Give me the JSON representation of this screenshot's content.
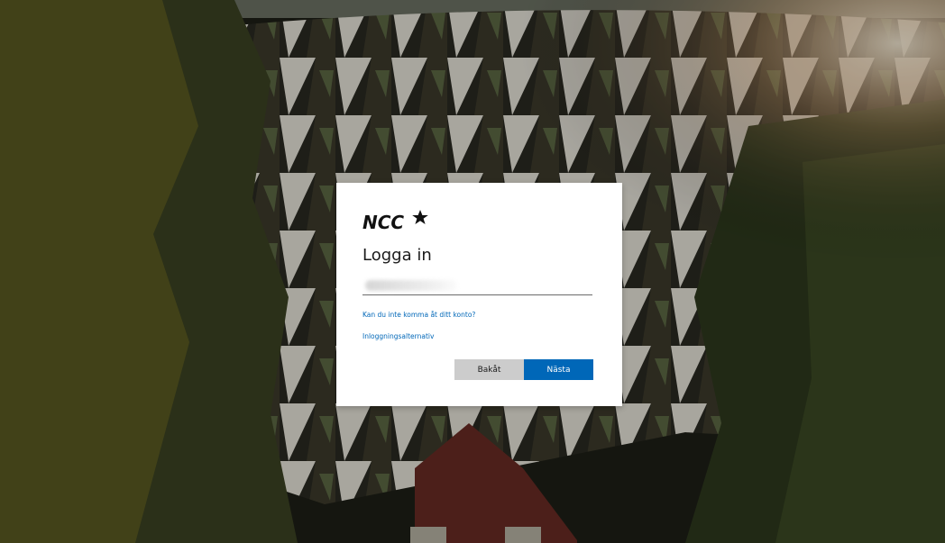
{
  "brand": {
    "logo_text": "NCC",
    "colors": {
      "accent": "#0067b8",
      "text": "#1b1b1b",
      "link": "#0067b8",
      "secondary_button": "#cccccc"
    }
  },
  "signin": {
    "title": "Logga in",
    "email": {
      "value": "",
      "placeholder": ""
    },
    "links": {
      "cant_access": "Kan du inte komma åt ditt konto?",
      "signin_options": "Inloggningsalternativ"
    },
    "buttons": {
      "back": "Bakåt",
      "next": "Nästa"
    }
  },
  "background": {
    "description_icon": "building-photo"
  }
}
